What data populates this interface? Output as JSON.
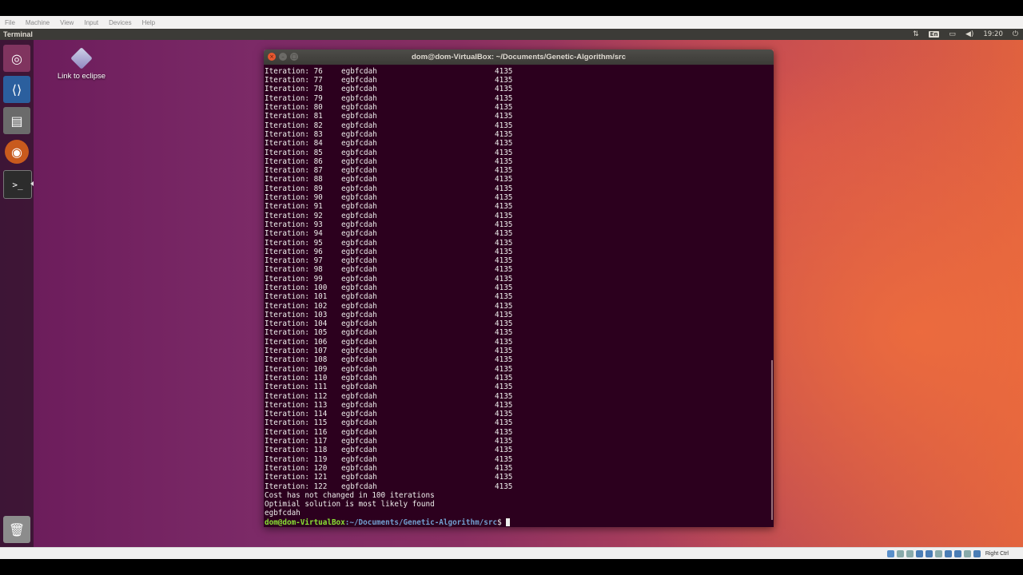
{
  "host_menu": [
    "File",
    "Machine",
    "View",
    "Input",
    "Devices",
    "Help"
  ],
  "host_status": {
    "hostkey_label": "Right Ctrl"
  },
  "topbar": {
    "app_title": "Terminal",
    "lang": "En",
    "clock": "19:20",
    "icons": [
      "network-icon",
      "keyboard-lang-icon",
      "battery-icon",
      "volume-icon",
      "power-icon"
    ]
  },
  "launcher": {
    "items": [
      {
        "name": "ubuntu-dash",
        "icon": "ubuntu-logo-icon"
      },
      {
        "name": "visual-studio-code",
        "icon": "vscode-icon"
      },
      {
        "name": "files",
        "icon": "file-cabinet-icon"
      },
      {
        "name": "firefox",
        "icon": "firefox-icon"
      },
      {
        "name": "terminal",
        "icon": "terminal-icon",
        "active": true
      },
      {
        "name": "trash",
        "icon": "trash-icon"
      }
    ]
  },
  "desktop_icon": {
    "label": "Link to eclipse",
    "icon": "eclipse-link-icon"
  },
  "terminal": {
    "title": "dom@dom-VirtualBox: ~/Documents/Genetic-Algorithm/src",
    "colors": {
      "background": "#2c001e",
      "text": "#eeeeec",
      "user": "#8ae234",
      "path": "#729fcf"
    },
    "iteration_label": "Iteration:",
    "iterations": {
      "start": 76,
      "end": 122,
      "path": "egbfcdah",
      "cost": "4135"
    },
    "messages": [
      "Cost has not changed in 100 iterations",
      "Optimial solution is most likely found",
      "egbfcdah"
    ],
    "prompt": {
      "user_host": "dom@dom-VirtualBox",
      "path": ":~/Documents/Genetic-Algorithm/src",
      "symbol": "$"
    }
  }
}
